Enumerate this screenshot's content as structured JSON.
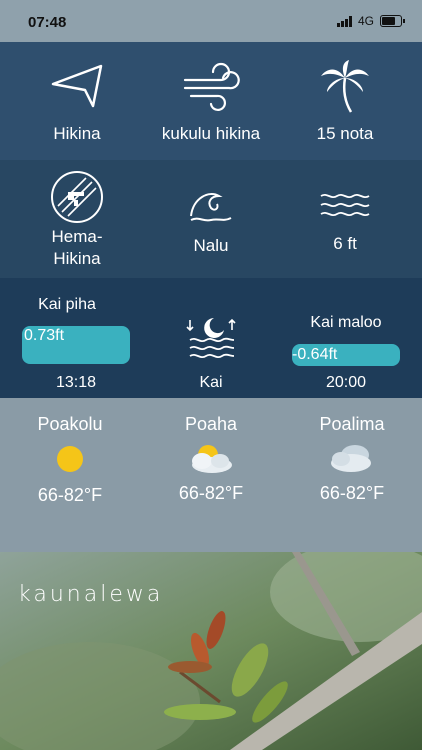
{
  "status": {
    "time": "07:48",
    "network": "4G"
  },
  "wind": {
    "direction_label": "Hikina",
    "type_label": "kukulu hikina",
    "speed_label": "15 nota"
  },
  "swell": {
    "direction_label": "Hema-Hikina",
    "direction_line1": "Hema-",
    "direction_line2": "Hikina",
    "type_label": "Nalu",
    "height_label": "6 ft"
  },
  "tide": {
    "high_label": "Kai piha",
    "high_value": "0.73ft",
    "high_time": "13:18",
    "center_label": "Kai",
    "low_label": "Kai maloo",
    "low_value": "-0.64ft",
    "low_time": "20:00",
    "bar_color": "#3ab1bf"
  },
  "forecast": [
    {
      "day": "Poakolu",
      "icon": "sun-icon",
      "range": "66-82°F"
    },
    {
      "day": "Poaha",
      "icon": "partly-cloudy-icon",
      "range": "66-82°F"
    },
    {
      "day": "Poalima",
      "icon": "cloudy-icon",
      "range": "66-82°F"
    }
  ],
  "brand": {
    "name": "kaunalewa"
  }
}
